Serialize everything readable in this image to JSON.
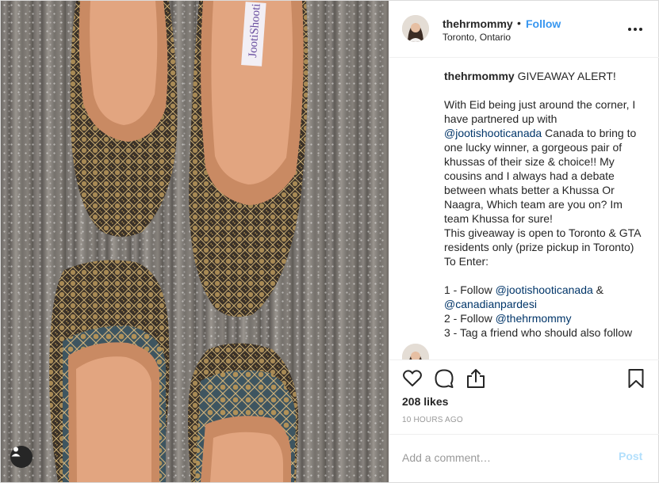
{
  "post": {
    "author": {
      "username": "thehrmommy",
      "follow_label": "Follow",
      "separator": "•",
      "location": "Toronto, Ontario"
    },
    "image": {
      "brand_label": "JootiShooti"
    },
    "caption": {
      "username": "thehrmommy",
      "line1": " GIVEAWAY ALERT!\n\nWith Eid being just around the corner, I have partnered up with ",
      "mention1": "@jootishooticanada",
      "line2": " Canada to bring to one lucky winner, a gorgeous pair of khussas of their size & choice!! My cousins and I always had a debate between whats better a Khussa Or Naagra, Which team are you on? Im team Khussa for sure!\nThis giveaway is open to Toronto & GTA residents only (prize pickup in Toronto)\nTo Enter:\n\n1 - Follow ",
      "mention2": "@jootishooticanada",
      "line3": " &\n",
      "mention3": "@canadianpardesi",
      "line4": "\n2 - Follow ",
      "mention4": "@thehrmommy",
      "line5": "\n3 - Tag a friend who should also follow"
    },
    "icons": {
      "like": "heart-icon",
      "comment": "comment-icon",
      "share": "share-icon",
      "save": "bookmark-icon",
      "more": "more-options-icon",
      "tag": "user-tag-icon"
    },
    "likes_text": "208 likes",
    "time_text": "10 HOURS AGO",
    "composer": {
      "placeholder": "Add a comment…",
      "post_label": "Post"
    },
    "colors": {
      "accent": "#3897f0",
      "mention": "#003569",
      "post_disabled": "#b2dffc",
      "muted": "#999999"
    }
  }
}
